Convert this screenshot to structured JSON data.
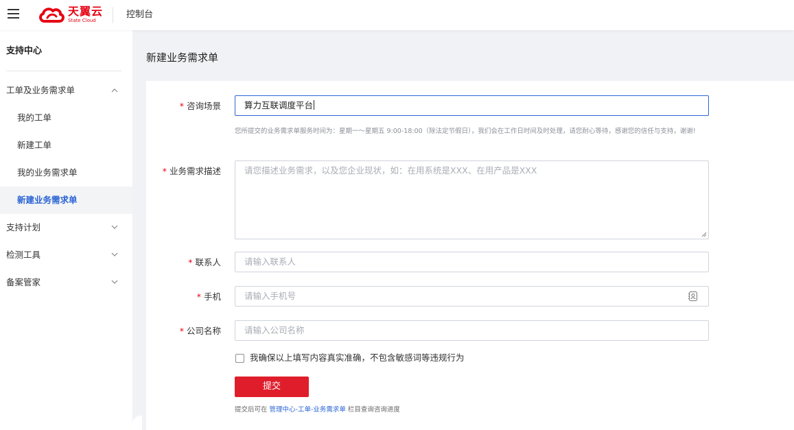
{
  "topbar": {
    "menu_icon": "hamburger-menu-icon",
    "logo": {
      "name": "天翼云",
      "tagline": "State Cloud",
      "color": "#e60012",
      "icon": "cloud-logo-icon"
    },
    "console_label": "控制台"
  },
  "sidebar": {
    "title": "支持中心",
    "items": [
      {
        "label": "工单及业务需求单",
        "type": "group",
        "expanded": true,
        "icon": "chevron-up-icon"
      },
      {
        "label": "我的工单",
        "type": "sub"
      },
      {
        "label": "新建工单",
        "type": "sub"
      },
      {
        "label": "我的业务需求单",
        "type": "sub"
      },
      {
        "label": "新建业务需求单",
        "type": "sub",
        "active": true
      },
      {
        "label": "支持计划",
        "type": "group",
        "expanded": false,
        "icon": "chevron-down-icon"
      },
      {
        "label": "检测工具",
        "type": "group",
        "expanded": false,
        "icon": "chevron-down-icon"
      },
      {
        "label": "备案管家",
        "type": "group",
        "expanded": false,
        "icon": "chevron-down-icon"
      }
    ],
    "active_color": "#2a64d4"
  },
  "main": {
    "page_title": "新建业务需求单",
    "form": {
      "required_mark": "*",
      "scenario": {
        "label": "咨询场景",
        "value": "算力互联调度平台"
      },
      "hint": "您所提交的业务需求单服务时间为：星期一～星期五 9:00-18:00（除法定节假日），我们会在工作日时间及时处理，请您耐心等待，感谢您的信任与支持，谢谢!",
      "description": {
        "label": "业务需求描述",
        "placeholder": "请您描述业务需求，以及您企业现状，如：在用系统是XXX、在用产品是XXX"
      },
      "contact": {
        "label": "联系人",
        "placeholder": "请输入联系人"
      },
      "phone": {
        "label": "手机",
        "placeholder": "请输入手机号",
        "icon": "contact-book-icon"
      },
      "company": {
        "label": "公司名称",
        "placeholder": "请输入公司名称"
      },
      "agreement": {
        "label": "我确保以上填写内容真实准确，不包含敏感词等违规行为",
        "checked": false
      },
      "submit_label": "提交",
      "submit_color": "#e01e2b",
      "footnote": {
        "prefix": "提交后可在 ",
        "link": "管理中心-工单-业务需求单",
        "suffix": " 栏目查询咨询进度"
      }
    }
  }
}
